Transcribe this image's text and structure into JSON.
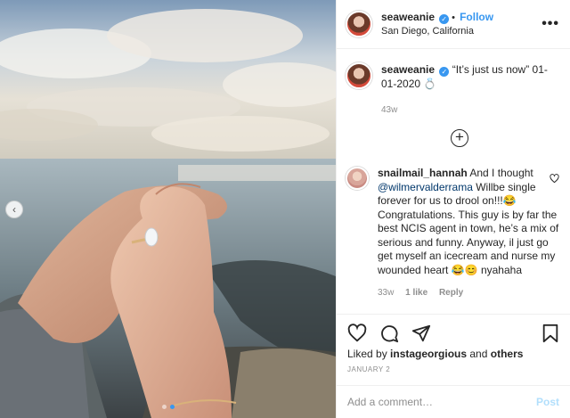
{
  "photo": {
    "alt_icon": "carousel-prev-icon",
    "carousel_total": 2,
    "carousel_active": 1
  },
  "header": {
    "username": "seaweanie",
    "follow_separator": "•",
    "follow_label": "Follow",
    "location": "San Diego, California",
    "more_label": "•••"
  },
  "caption": {
    "username": "seaweanie",
    "text": "“It’s just us now” 01-01-2020 💍",
    "time": "43w"
  },
  "load_more_label": "+",
  "comment": {
    "username": "snailmail_hannah",
    "text_before": " And I thought ",
    "mention": "@wilmervalderrama",
    "text_after": " Willbe single forever for us to drool on!!!😂 Congratulations. This guy is by far the best NCIS agent in town, he’s a mix of serious and funny. Anyway, il just go get myself an icecream and nurse my wounded heart 😂😊 nyahaha",
    "time": "33w",
    "likes": "1 like",
    "reply_label": "Reply"
  },
  "likes": {
    "prefix": "Liked by ",
    "user": "instageorgious",
    "middle": " and ",
    "others": "others"
  },
  "date": "JANUARY 2",
  "add_comment": {
    "placeholder": "Add a comment…",
    "post_label": "Post"
  },
  "colors": {
    "accent": "#3897f0",
    "post_disabled": "#b2dffc",
    "secondary_text": "#8e8e8e"
  }
}
